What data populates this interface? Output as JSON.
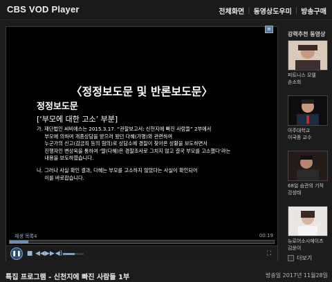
{
  "app": {
    "title": "CBS VOD Player"
  },
  "nav": {
    "items": [
      {
        "label": "전체화면"
      },
      {
        "label": "동영상도우미"
      },
      {
        "label": "방송구매"
      }
    ]
  },
  "player": {
    "correction_title": "〈정정보도문 및 반론보도문〉",
    "section_heading": "정정보도문",
    "section_subheading": "[‘부모에 대한 고소’ 부분]",
    "paragraphs": [
      "가. 재단법인 씨비에스는 2015.3.17. “관찰보고서: 신천지에 빠진 사람들” 2부에서\n     부모에 의하여 개종상담을 받으러 왔던 다혜(가명)와 관련하여\n     누군가의 신고(감금죄 등의 혐의)로 상담소에 경찰이 찾아온 상황을 보도하면서\n     진행자인 변상욱을 통하여 ‘딸(다혜)은 경찰조사로 그치지 않고 결국 부모를 고소했다’라는\n     내용을 보도하였습니다.",
      "나. 그러나 사실 확인 결과, 다혜는 부모를 고소하지 않았다는 사실이 확인되어\n     이를 바로잡습니다."
    ],
    "caption_label": "재생 목록4",
    "time": "00:19",
    "progress": 0.07,
    "volume": 0.55
  },
  "sidebar": {
    "header": "강력추천 동영상",
    "items": [
      {
        "caption": "피트니스 모델\n손소희"
      },
      {
        "caption": "아주대학교\n이국종 교수"
      },
      {
        "caption": "68일 슴관의 기적\n강성태"
      },
      {
        "caption": "뉴로어소시에이츠\n김윤이"
      }
    ],
    "more_label": "더보기"
  },
  "footer": {
    "video_title": "특집 프로그램 - 신천지에 빠진 사람들 1부",
    "air_date": "방송일 2017년 11월28일"
  }
}
